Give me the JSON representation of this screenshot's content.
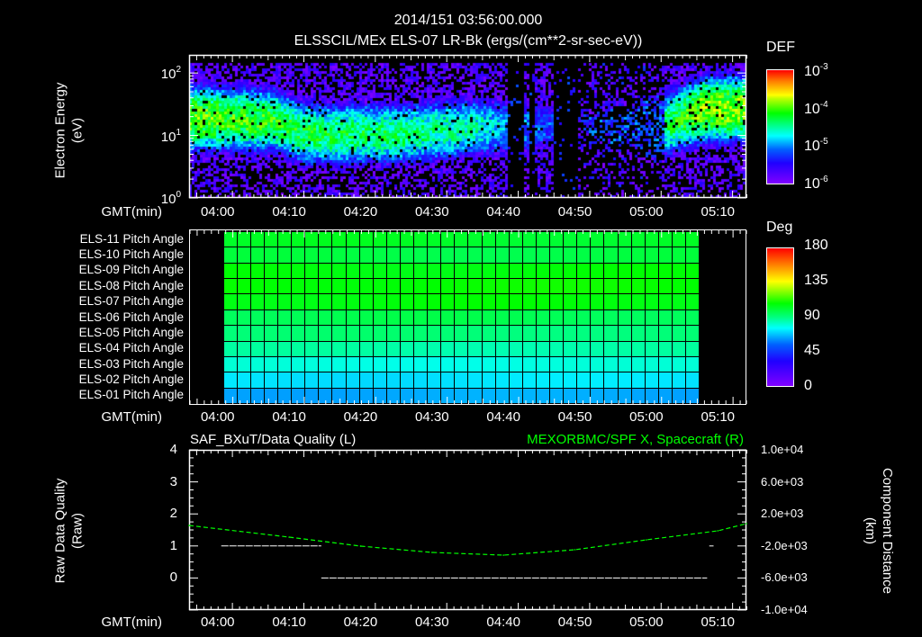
{
  "header": {
    "timestamp": "2014/151 03:56:00.000",
    "title": "ELSSCIL/MEx ELS-07 LR-Bk  (ergs/(cm**2-sr-sec-eV))"
  },
  "gmt_label": "GMT(min)",
  "time_ticks": [
    "04:00",
    "04:10",
    "04:20",
    "04:30",
    "04:40",
    "04:50",
    "05:00",
    "05:10"
  ],
  "colors": {
    "quality_line": "#ffffff",
    "position_line": "#00ff00",
    "background": "#000000"
  },
  "chart_data": [
    {
      "type": "heatmap",
      "name": "electron-spectrogram",
      "ylabel_line1": "Electron Energy",
      "ylabel_line2": "(eV)",
      "y_scale": "log",
      "ylim": [
        1,
        195
      ],
      "y_ticks": [
        {
          "base": "10",
          "exp": "2",
          "value": 100
        },
        {
          "base": "10",
          "exp": "1",
          "value": 10
        },
        {
          "base": "10",
          "exp": "0",
          "value": 1
        }
      ],
      "x_range_min_after_0356": [
        0,
        78
      ],
      "profile": [
        {
          "t": 0,
          "center_eV": 20,
          "peak_logDEF": -4.0
        },
        {
          "t": 12,
          "center_eV": 18,
          "peak_logDEF": -4.2
        },
        {
          "t": 16,
          "center_eV": 11,
          "peak_logDEF": -4.3
        },
        {
          "t": 30,
          "center_eV": 11,
          "peak_logDEF": -4.4
        },
        {
          "t": 40,
          "center_eV": 14,
          "peak_logDEF": -4.6
        },
        {
          "t": 44,
          "center_eV": 14,
          "peak_logDEF": -4.9
        },
        {
          "t": 55,
          "center_eV": 14,
          "peak_logDEF": -5.4
        },
        {
          "t": 66,
          "center_eV": 15,
          "peak_logDEF": -4.4
        },
        {
          "t": 72,
          "center_eV": 28,
          "peak_logDEF": -3.9
        },
        {
          "t": 78,
          "center_eV": 28,
          "peak_logDEF": -3.9
        }
      ],
      "data_gaps": [
        [
          "04:40:20",
          "04:42:30"
        ],
        [
          "04:43:30",
          "04:44:20"
        ],
        [
          "04:47:00",
          "04:50:20"
        ]
      ],
      "sparse_interval": [
        "04:50:20",
        "05:02:30"
      ],
      "colorbar": {
        "title": "DEF",
        "scale": "log",
        "range": [
          -6,
          -3
        ],
        "ticks": [
          {
            "base": "10",
            "exp": "-3"
          },
          {
            "base": "10",
            "exp": "-4"
          },
          {
            "base": "10",
            "exp": "-5"
          },
          {
            "base": "10",
            "exp": "-6"
          }
        ]
      }
    },
    {
      "type": "heatmap",
      "name": "pitch-angle-grid",
      "rows": [
        "ELS-11 Pitch Angle",
        "ELS-10 Pitch Angle",
        "ELS-09 Pitch Angle",
        "ELS-08 Pitch Angle",
        "ELS-07 Pitch Angle",
        "ELS-06 Pitch Angle",
        "ELS-05 Pitch Angle",
        "ELS-04 Pitch Angle",
        "ELS-03 Pitch Angle",
        "ELS-02 Pitch Angle",
        "ELS-01 Pitch Angle"
      ],
      "row_values_deg": [
        106,
        102,
        110,
        112,
        110,
        100,
        95,
        88,
        80,
        72,
        64
      ],
      "columns": 35,
      "x_start": "04:00:45",
      "x_end": "05:07:20",
      "colorbar": {
        "title": "Deg",
        "range": [
          0,
          180
        ],
        "ticks": [
          "180",
          "135",
          "90",
          "45",
          "0"
        ]
      }
    },
    {
      "type": "line",
      "title_left": "SAF_BXuT/Data Quality (L)",
      "title_right": "MEXORBMC/SPF X, Spacecraft (R)",
      "ylabel_left_line1": "Raw Data Quality",
      "ylabel_left_line2": "(Raw)",
      "ylabel_right_line1": "Component Distance",
      "ylabel_right_line2": "(km)",
      "ylim_left": [
        -1,
        4
      ],
      "left_ticks": [
        "4",
        "3",
        "2",
        "1",
        "0"
      ],
      "ylim_right": [
        -10000,
        10000
      ],
      "right_ticks": [
        "1.0e+04",
        "6.0e+03",
        "2.0e+03",
        "-2.0e+03",
        "-6.0e+03",
        "-1.0e+04"
      ],
      "quality_segments": [
        {
          "from": 4.5,
          "to": 18.5,
          "value": 1
        },
        {
          "from": 18.5,
          "to": 72.5,
          "value": 0
        },
        {
          "from": 72.8,
          "to": 73.4,
          "value": 1
        }
      ],
      "position_series": {
        "x_min_after_0356": [
          0,
          14,
          24,
          34,
          44,
          54,
          64,
          74,
          78
        ],
        "y_km": [
          560,
          -900,
          -2020,
          -2810,
          -3150,
          -2470,
          -1240,
          -110,
          790
        ]
      }
    }
  ]
}
